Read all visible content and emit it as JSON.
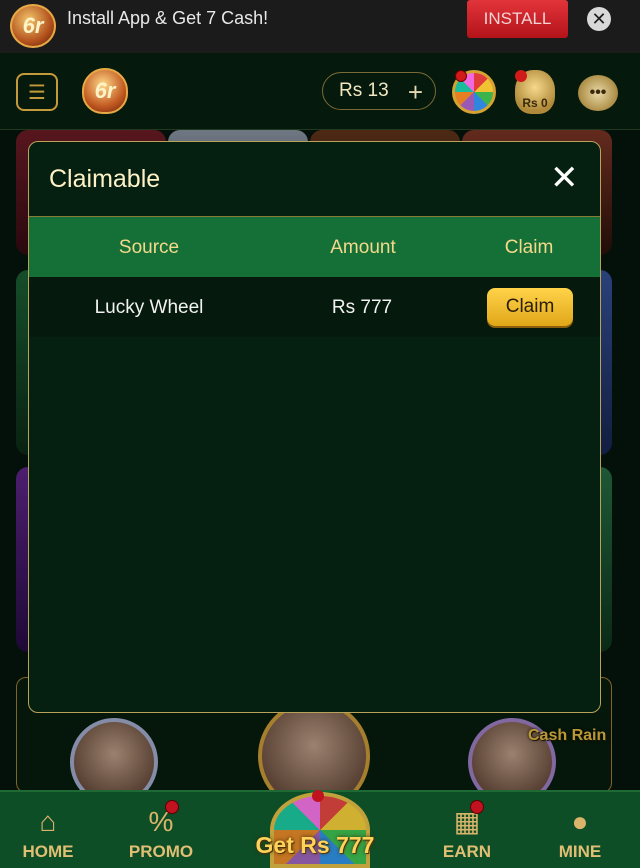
{
  "install_banner": {
    "logo_text": "6r",
    "text": "Install App & Get 7 Cash!",
    "button_label": "INSTALL",
    "close_glyph": "✕"
  },
  "header": {
    "logo_text": "6r",
    "balance": "Rs 13",
    "balance_plus": "+",
    "bag_label": "Rs 0",
    "icons": [
      "menu-icon",
      "lucky-wheel-icon",
      "money-bag-icon",
      "support-chat-icon"
    ]
  },
  "modal": {
    "title": "Claimable",
    "close_glyph": "✕",
    "columns": {
      "source": "Source",
      "amount": "Amount",
      "claim": "Claim"
    },
    "rows": [
      {
        "source": "Lucky Wheel",
        "amount": "Rs 777",
        "claim_label": "Claim"
      }
    ]
  },
  "background": {
    "cash_rain_label": "Cash Rain"
  },
  "bottom_nav": {
    "items": [
      {
        "label": "HOME",
        "icon": "home-icon"
      },
      {
        "label": "PROMO",
        "icon": "promo-icon"
      },
      {
        "label": "EARN",
        "icon": "gift-icon"
      },
      {
        "label": "MINE",
        "icon": "user-icon"
      }
    ],
    "center_label": "Get Rs 777"
  },
  "colors": {
    "accent_gold": "#f5d98a",
    "table_header_green": "#157038",
    "claim_button": "#ffd34a",
    "install_red": "#d3222a"
  }
}
